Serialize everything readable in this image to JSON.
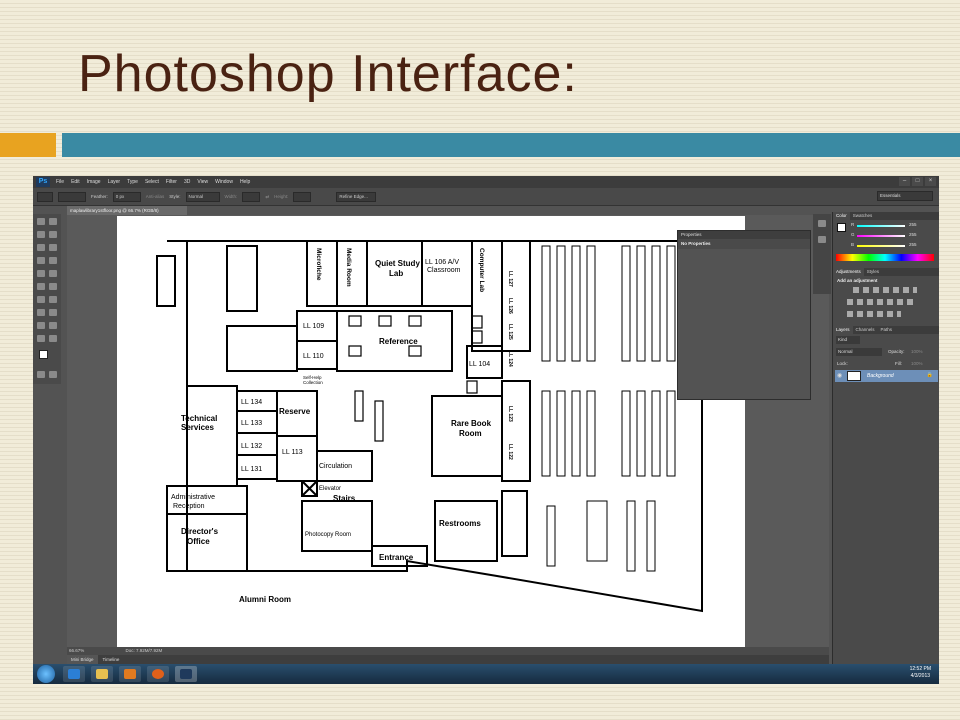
{
  "slide": {
    "title": "Photoshop Interface:"
  },
  "app": {
    "logo": "Ps",
    "menu": [
      "File",
      "Edit",
      "Image",
      "Layer",
      "Type",
      "Select",
      "Filter",
      "3D",
      "View",
      "Window",
      "Help"
    ],
    "window_controls": [
      "–",
      "□",
      "×"
    ],
    "options": {
      "feather_label": "Feather:",
      "feather_value": "0 px",
      "anti_alias": "Anti-alias",
      "style_label": "Style:",
      "style_value": "Normal",
      "width_label": "Width:",
      "height_label": "Height:",
      "refine_edge": "Refine Edge...",
      "workspace": "Essentials"
    },
    "document_tab": "maplawlibrary1stfloor.png @ 66.7% (RGB/8)",
    "status": {
      "zoom": "66.67%",
      "doc": "Doc: 7.92M/7.92M"
    },
    "bottom_tabs": [
      "Mini Bridge",
      "Timeline"
    ],
    "properties_panel": {
      "title": "Properties",
      "body": "No Properties"
    },
    "color_panel": {
      "tabs": [
        "Color",
        "Swatches"
      ],
      "r": "255",
      "g": "255",
      "b": "255",
      "r_label": "R",
      "g_label": "G",
      "b_label": "B"
    },
    "adjustments_panel": {
      "tabs": [
        "Adjustments",
        "Styles"
      ],
      "heading": "Add an adjustment"
    },
    "layers_panel": {
      "tabs": [
        "Layers",
        "Channels",
        "Paths"
      ],
      "kind": "Kind",
      "blend": "Normal",
      "opacity_label": "Opacity:",
      "opacity": "100%",
      "lock_label": "Lock:",
      "fill_label": "Fill:",
      "fill": "100%",
      "layer_name": "Background"
    },
    "taskbar": {
      "time": "12:52 PM",
      "date": "4/3/2013"
    }
  },
  "floorplan": {
    "rooms": {
      "microfiche": "Microfiche",
      "media_room": "Media Room",
      "quiet_study": "Quiet Study",
      "lab": "Lab",
      "ll106": "LL 106 A/V",
      "classroom": "Classroom",
      "computer_lab": "Computer Lab",
      "ll109": "LL 109",
      "ll110": "LL 110",
      "reference": "Reference",
      "ll104": "LL 104",
      "self_help": "Self-Help",
      "collection": "Collection",
      "technical": "Technical",
      "services": "Services",
      "ll134": "LL 134",
      "ll133": "LL 133",
      "ll132": "LL 132",
      "ll131": "LL 131",
      "ll113": "LL 113",
      "reserve": "Reserve",
      "circulation": "Circulation",
      "rare_book": "Rare Book",
      "room": "Room",
      "ll127": "LL 127",
      "ll126": "LL 126",
      "ll125": "LL 125",
      "ll124": "LL 124",
      "ll123": "LL 123",
      "ll122": "LL 122",
      "administrative": "Administrative",
      "reception": "Reception",
      "elevator": "Elevator",
      "stairs": "Stairs",
      "directors": "Director's",
      "office": "Office",
      "photocopy": "Photocopy Room",
      "entrance": "Entrance",
      "restrooms": "Restrooms",
      "alumni": "Alumni Room"
    }
  },
  "colors": {
    "title": "#4a2212",
    "orange_bar": "#e8a320",
    "teal_bar": "#3a8aa3",
    "ps_dark": "#535353"
  }
}
